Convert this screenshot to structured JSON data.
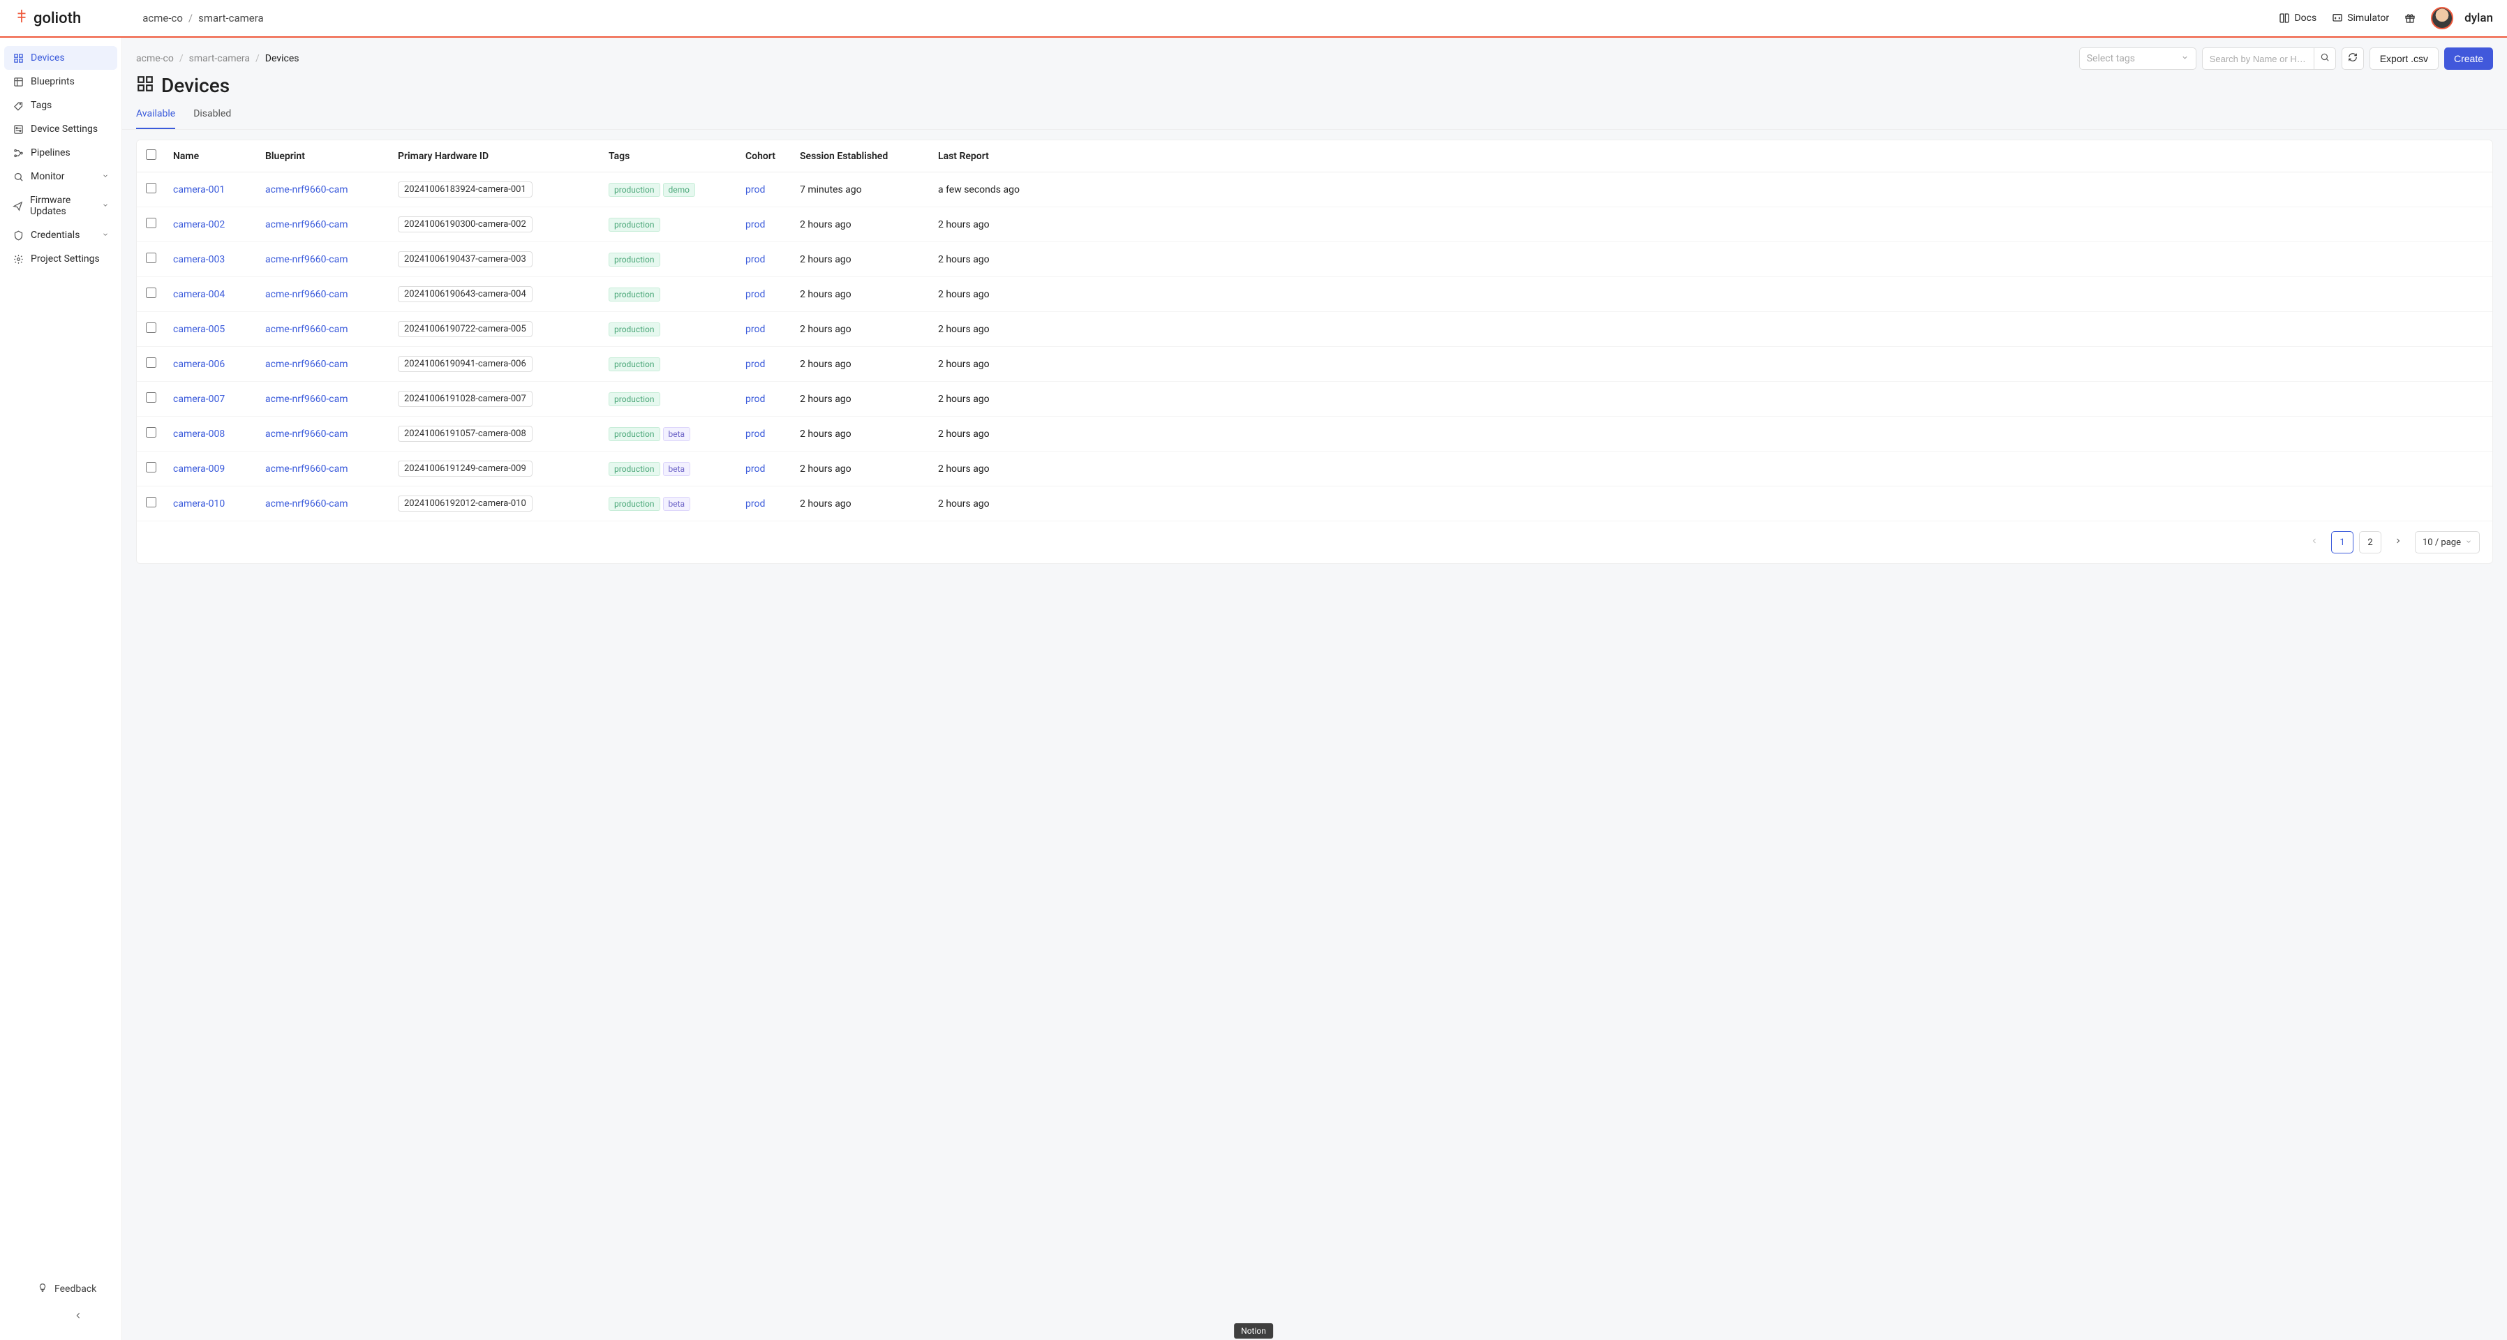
{
  "brand": "golioth",
  "top_breadcrumb": {
    "org": "acme-co",
    "project": "smart-camera",
    "sep": "/"
  },
  "top_links": {
    "docs": "Docs",
    "simulator": "Simulator"
  },
  "user": {
    "name": "dylan"
  },
  "sidebar": {
    "items": [
      {
        "label": "Devices",
        "icon": "grid",
        "active": true
      },
      {
        "label": "Blueprints",
        "icon": "blueprint"
      },
      {
        "label": "Tags",
        "icon": "tag"
      },
      {
        "label": "Device Settings",
        "icon": "settings-panel"
      },
      {
        "label": "Pipelines",
        "icon": "pipeline"
      },
      {
        "label": "Monitor",
        "icon": "search",
        "expandable": true
      },
      {
        "label": "Firmware Updates",
        "icon": "send",
        "expandable": true
      },
      {
        "label": "Credentials",
        "icon": "shield",
        "expandable": true
      },
      {
        "label": "Project Settings",
        "icon": "gear"
      }
    ],
    "feedback": "Feedback"
  },
  "crumbs": {
    "org": "acme-co",
    "project": "smart-camera",
    "current": "Devices",
    "sep": "/"
  },
  "toolbar": {
    "select_tags_placeholder": "Select tags",
    "search_placeholder": "Search by Name or H…",
    "export_label": "Export .csv",
    "create_label": "Create"
  },
  "page": {
    "title": "Devices"
  },
  "tabs": {
    "available": "Available",
    "disabled": "Disabled",
    "active": 0
  },
  "table": {
    "columns": [
      "Name",
      "Blueprint",
      "Primary Hardware ID",
      "Tags",
      "Cohort",
      "Session Established",
      "Last Report"
    ],
    "rows": [
      {
        "name": "camera-001",
        "blueprint": "acme-nrf9660-cam",
        "hwid": "20241006183924-camera-001",
        "tags": [
          "production",
          "demo"
        ],
        "cohort": "prod",
        "session": "7 minutes ago",
        "last_report": "a few seconds ago"
      },
      {
        "name": "camera-002",
        "blueprint": "acme-nrf9660-cam",
        "hwid": "20241006190300-camera-002",
        "tags": [
          "production"
        ],
        "cohort": "prod",
        "session": "2 hours ago",
        "last_report": "2 hours ago"
      },
      {
        "name": "camera-003",
        "blueprint": "acme-nrf9660-cam",
        "hwid": "20241006190437-camera-003",
        "tags": [
          "production"
        ],
        "cohort": "prod",
        "session": "2 hours ago",
        "last_report": "2 hours ago"
      },
      {
        "name": "camera-004",
        "blueprint": "acme-nrf9660-cam",
        "hwid": "20241006190643-camera-004",
        "tags": [
          "production"
        ],
        "cohort": "prod",
        "session": "2 hours ago",
        "last_report": "2 hours ago"
      },
      {
        "name": "camera-005",
        "blueprint": "acme-nrf9660-cam",
        "hwid": "20241006190722-camera-005",
        "tags": [
          "production"
        ],
        "cohort": "prod",
        "session": "2 hours ago",
        "last_report": "2 hours ago"
      },
      {
        "name": "camera-006",
        "blueprint": "acme-nrf9660-cam",
        "hwid": "20241006190941-camera-006",
        "tags": [
          "production"
        ],
        "cohort": "prod",
        "session": "2 hours ago",
        "last_report": "2 hours ago"
      },
      {
        "name": "camera-007",
        "blueprint": "acme-nrf9660-cam",
        "hwid": "20241006191028-camera-007",
        "tags": [
          "production"
        ],
        "cohort": "prod",
        "session": "2 hours ago",
        "last_report": "2 hours ago"
      },
      {
        "name": "camera-008",
        "blueprint": "acme-nrf9660-cam",
        "hwid": "20241006191057-camera-008",
        "tags": [
          "production",
          "beta"
        ],
        "cohort": "prod",
        "session": "2 hours ago",
        "last_report": "2 hours ago"
      },
      {
        "name": "camera-009",
        "blueprint": "acme-nrf9660-cam",
        "hwid": "20241006191249-camera-009",
        "tags": [
          "production",
          "beta"
        ],
        "cohort": "prod",
        "session": "2 hours ago",
        "last_report": "2 hours ago"
      },
      {
        "name": "camera-010",
        "blueprint": "acme-nrf9660-cam",
        "hwid": "20241006192012-camera-010",
        "tags": [
          "production",
          "beta"
        ],
        "cohort": "prod",
        "session": "2 hours ago",
        "last_report": "2 hours ago"
      }
    ]
  },
  "pagination": {
    "pages": [
      "1",
      "2"
    ],
    "current": 0,
    "size_label": "10 / page"
  },
  "tooltip": "Notion"
}
